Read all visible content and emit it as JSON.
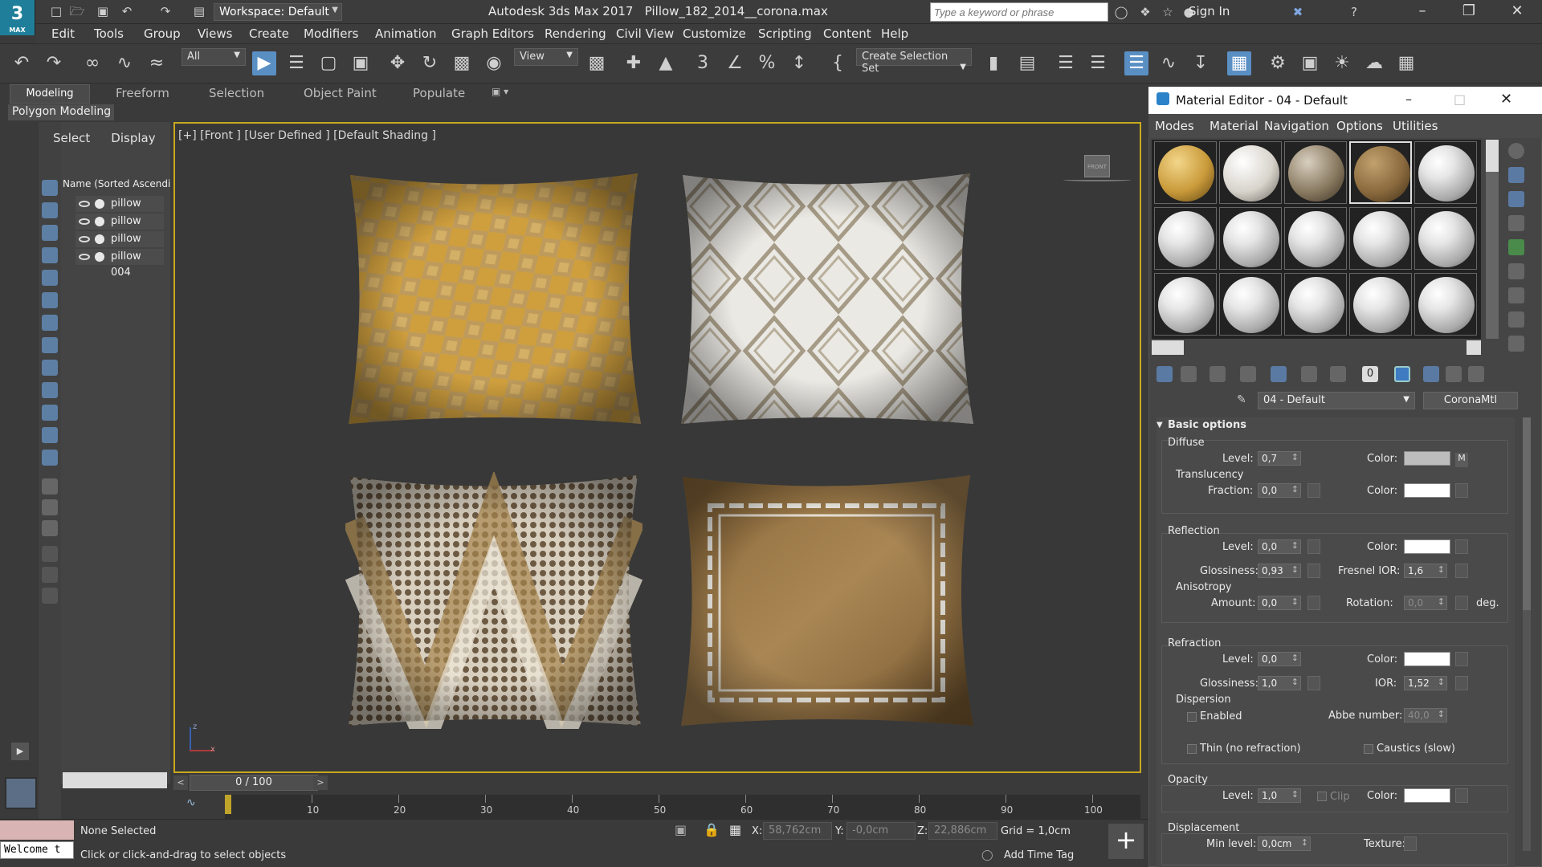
{
  "app": {
    "logo_text": "3",
    "logo_sub": "MAX",
    "workspace": "Workspace: Default",
    "title": "Autodesk 3ds Max 2017",
    "filename": "Pillow_182_2014__corona.max",
    "search_placeholder": "Type a keyword or phrase",
    "signin": "Sign In"
  },
  "menu": [
    "Edit",
    "Tools",
    "Group",
    "Views",
    "Create",
    "Modifiers",
    "Animation",
    "Graph Editors",
    "Rendering",
    "Civil View",
    "Customize",
    "Scripting",
    "Content",
    "Help"
  ],
  "toolbar": {
    "filter": "All",
    "ref_coord": "View",
    "selection_set": "Create Selection Set"
  },
  "ribbon": {
    "tabs": [
      "Modeling",
      "Freeform",
      "Selection",
      "Object Paint",
      "Populate"
    ],
    "panel": "Polygon Modeling"
  },
  "explorer": {
    "tabs": [
      "Select",
      "Display"
    ],
    "header": "Name (Sorted Ascendi",
    "items": [
      "pillow 001",
      "pillow 002",
      "pillow 003",
      "pillow 004"
    ]
  },
  "viewport": {
    "label": "[+] [Front ] [User Defined ] [Default Shading ]",
    "viewcube_label": "FRONT",
    "axis_y": "z",
    "axis_x": "x"
  },
  "pillows": [
    {
      "name": "pillow-gold-pattern",
      "color": "#c99a3a"
    },
    {
      "name": "pillow-white-diamond",
      "color": "#e9e6e0"
    },
    {
      "name": "pillow-chevron-dots",
      "color": "#bfae8f"
    },
    {
      "name": "pillow-brown-border",
      "color": "#8a6a3e"
    }
  ],
  "timeline": {
    "slider": "0 / 100",
    "ticks": [
      "10",
      "20",
      "30",
      "40",
      "50",
      "60",
      "70",
      "80",
      "90",
      "100"
    ]
  },
  "status": {
    "welcome": "Welcome t",
    "selection": "None Selected",
    "prompt": "Click or click-and-drag to select objects",
    "x_label": "X:",
    "x_value": "58,762cm",
    "y_label": "Y:",
    "y_value": "-0,0cm",
    "z_label": "Z:",
    "z_value": "22,886cm",
    "grid": "Grid = 1,0cm",
    "add_time_tag": "Add Time Tag"
  },
  "material_editor": {
    "title": "Material Editor - 04 - Default",
    "menu": [
      "Modes",
      "Material",
      "Navigation",
      "Options",
      "Utilities"
    ],
    "material_name": "04 - Default",
    "material_type": "CoronaMtl",
    "basic_options": "Basic options",
    "diffuse": {
      "title": "Diffuse",
      "level_label": "Level:",
      "level": "0,7",
      "color_label": "Color:",
      "map_button": "M",
      "translucency": "Translucency",
      "fraction_label": "Fraction:",
      "fraction": "0,0",
      "t_color_label": "Color:"
    },
    "reflection": {
      "title": "Reflection",
      "level_label": "Level:",
      "level": "0,0",
      "color_label": "Color:",
      "glossiness_label": "Glossiness:",
      "glossiness": "0,93",
      "fresnel_label": "Fresnel IOR:",
      "fresnel": "1,6",
      "anisotropy": "Anisotropy",
      "amount_label": "Amount:",
      "amount": "0,0",
      "rotation_label": "Rotation:",
      "rotation": "0,0",
      "deg": "deg."
    },
    "refraction": {
      "title": "Refraction",
      "level_label": "Level:",
      "level": "0,0",
      "color_label": "Color:",
      "glossiness_label": "Glossiness:",
      "glossiness": "1,0",
      "ior_label": "IOR:",
      "ior": "1,52",
      "dispersion": "Dispersion",
      "enabled": "Enabled",
      "abbe_label": "Abbe number:",
      "abbe": "40,0",
      "thin": "Thin (no refraction)",
      "caustics": "Caustics (slow)"
    },
    "opacity": {
      "title": "Opacity",
      "level_label": "Level:",
      "level": "1,0",
      "clip": "Clip",
      "color_label": "Color:"
    },
    "displacement": {
      "title": "Displacement",
      "min_label": "Min level:",
      "min": "0,0cm",
      "texture_label": "Texture:"
    }
  }
}
